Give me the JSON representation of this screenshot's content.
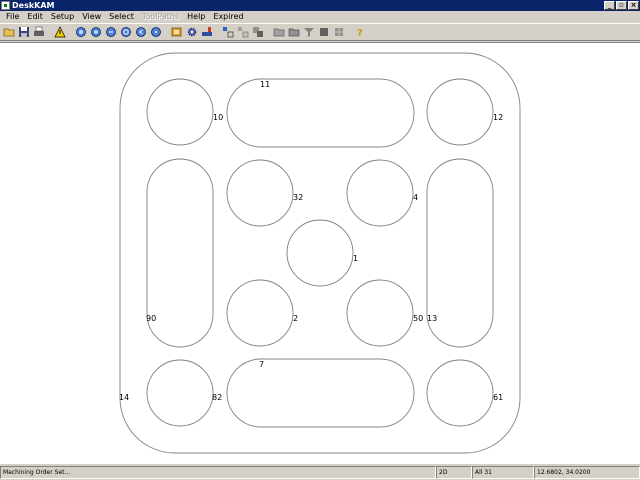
{
  "window": {
    "title": "DeskKAM"
  },
  "window_buttons": {
    "minimize": "_",
    "restore": "▫",
    "close": "×"
  },
  "menu": {
    "file": "File",
    "edit": "Edit",
    "setup": "Setup",
    "view": "View",
    "select": "Select",
    "toolpaths": "ToolPaths",
    "help": "Help",
    "expired": "Expired"
  },
  "toolbar_icons": [
    "open-folder-icon",
    "save-icon",
    "print-icon",
    "warning-icon",
    "zoom-fit-icon",
    "zoom-in-icon",
    "zoom-out-icon",
    "zoom-window-icon",
    "zoom-previous-icon",
    "zoom-extents-icon",
    "layers-icon",
    "settings-gear-icon",
    "machine-icon",
    "select-icon",
    "select-group-icon",
    "group-icon",
    "folder-icon",
    "folder-open-icon",
    "filter-icon",
    "block-icon",
    "grid-icon",
    "help-icon"
  ],
  "labels": {
    "l1": "1",
    "l2": "2",
    "l4": "4",
    "l7": "7",
    "l10": "10",
    "l11": "11",
    "l12": "12",
    "l13": "13",
    "l14": "14",
    "l32": "32",
    "l50": "50",
    "l61": "61",
    "l82": "82",
    "l90": "90"
  },
  "status": {
    "message": "Machining Order Set...",
    "mode": "2D",
    "selection": "All 31",
    "coords": "12.6802, 34.0200"
  },
  "colors": {
    "outline": "#808080",
    "canvas": "#ffffff",
    "titlebar": "#0a246a"
  }
}
